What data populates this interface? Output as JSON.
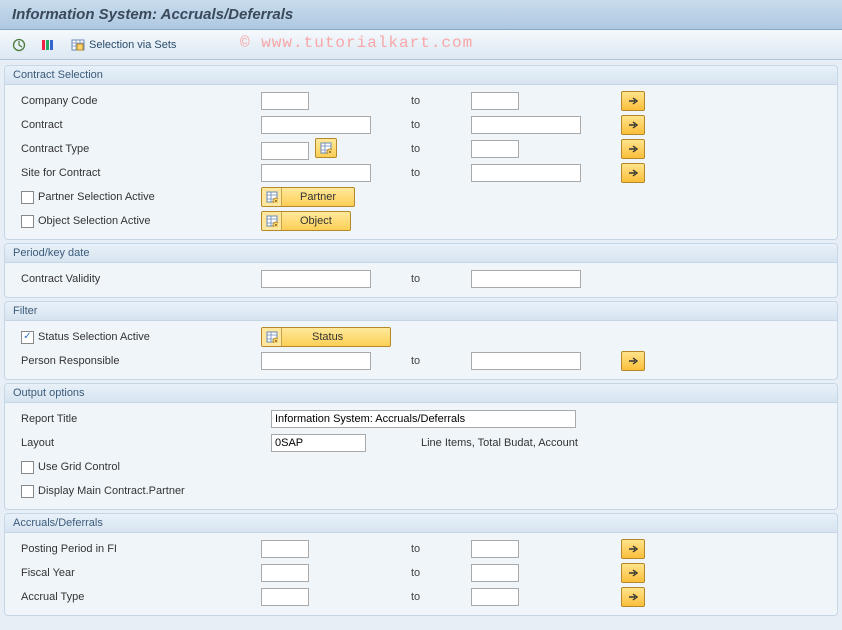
{
  "title": "Information System: Accruals/Deferrals",
  "toolbar": {
    "selection_via_sets": "Selection via Sets"
  },
  "watermark": "© www.tutorialkart.com",
  "to_label": "to",
  "groups": {
    "contract": {
      "title": "Contract Selection",
      "company_code": "Company Code",
      "contract": "Contract",
      "contract_type": "Contract Type",
      "site_for_contract": "Site for Contract",
      "partner_sel": "Partner Selection Active",
      "object_sel": "Object Selection Active",
      "btn_partner": "Partner",
      "btn_object": "Object"
    },
    "period": {
      "title": "Period/key date",
      "contract_validity": "Contract Validity"
    },
    "filter": {
      "title": "Filter",
      "status_sel": "Status Selection Active",
      "btn_status": "Status",
      "person_resp": "Person Responsible"
    },
    "output": {
      "title": "Output options",
      "report_title_lbl": "Report Title",
      "report_title_val": "Information System: Accruals/Deferrals",
      "layout_lbl": "Layout",
      "layout_val": "0SAP",
      "layout_info": "Line Items, Total Budat, Account",
      "grid": "Use Grid Control",
      "main_partner": "Display Main Contract.Partner"
    },
    "accr": {
      "title": "Accruals/Deferrals",
      "posting_period": "Posting Period in FI",
      "fiscal_year": "Fiscal Year",
      "accrual_type": "Accrual Type"
    }
  }
}
